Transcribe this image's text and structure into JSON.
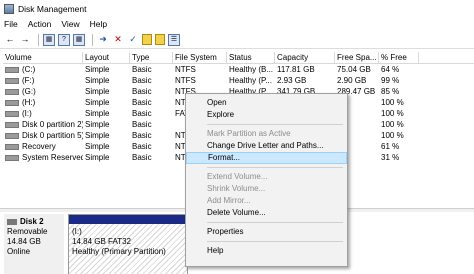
{
  "window": {
    "title": "Disk Management"
  },
  "menubar": {
    "items": [
      "File",
      "Action",
      "View",
      "Help"
    ]
  },
  "toolbar": {
    "icons": [
      "back-icon",
      "forward-icon",
      "properties-icon",
      "help-icon",
      "connect-icon",
      "delete-icon",
      "check-icon",
      "folder-icon",
      "new-icon"
    ]
  },
  "volume_list": {
    "headers": [
      "Volume",
      "Layout",
      "Type",
      "File System",
      "Status",
      "Capacity",
      "Free Spa...",
      "% Free"
    ],
    "rows": [
      [
        "(C:)",
        "Simple",
        "Basic",
        "NTFS",
        "Healthy (B...",
        "117.81 GB",
        "75.04 GB",
        "64 %"
      ],
      [
        "(F:)",
        "Simple",
        "Basic",
        "NTFS",
        "Healthy (P...",
        "2.93 GB",
        "2.90 GB",
        "99 %"
      ],
      [
        "(G:)",
        "Simple",
        "Basic",
        "NTFS",
        "Healthy (P...",
        "341.79 GB",
        "289.47 GB",
        "85 %"
      ],
      [
        "(H:)",
        "Simple",
        "Basic",
        "NT",
        "",
        "",
        "",
        "100 %"
      ],
      [
        "(I:)",
        "Simple",
        "Basic",
        "FAT",
        "",
        "",
        "",
        "100 %"
      ],
      [
        "Disk 0 partition 2)",
        "Simple",
        "Basic",
        "",
        "",
        "",
        "",
        "100 %"
      ],
      [
        "Disk 0 partition 5)",
        "Simple",
        "Basic",
        "NT",
        "",
        "",
        "",
        "100 %"
      ],
      [
        "Recovery",
        "Simple",
        "Basic",
        "NT",
        "",
        "",
        "",
        "61 %"
      ],
      [
        "System Reserved (...",
        "Simple",
        "Basic",
        "NT",
        "",
        "",
        "",
        "31 %"
      ]
    ]
  },
  "disk": {
    "name": "Disk 2",
    "kind": "Removable",
    "size": "14.84 GB",
    "status": "Online",
    "partition": {
      "label": "(I:)",
      "size_fs": "14.84 GB FAT32",
      "status": "Healthy (Primary Partition)"
    }
  },
  "context_menu": {
    "items": [
      {
        "label": "Open",
        "enabled": true
      },
      {
        "label": "Explore",
        "enabled": true
      },
      {
        "separator": true
      },
      {
        "label": "Mark Partition as Active",
        "enabled": false
      },
      {
        "label": "Change Drive Letter and Paths...",
        "enabled": true
      },
      {
        "label": "Format...",
        "enabled": true,
        "selected": true
      },
      {
        "separator": true
      },
      {
        "label": "Extend Volume...",
        "enabled": false
      },
      {
        "label": "Shrink Volume...",
        "enabled": false
      },
      {
        "label": "Add Mirror...",
        "enabled": false
      },
      {
        "label": "Delete Volume...",
        "enabled": true
      },
      {
        "separator": true
      },
      {
        "label": "Properties",
        "enabled": true
      },
      {
        "separator": true
      },
      {
        "label": "Help",
        "enabled": true
      }
    ]
  },
  "colors": {
    "partition_bar": "#1b2a86",
    "selection": "#cce8ff"
  }
}
